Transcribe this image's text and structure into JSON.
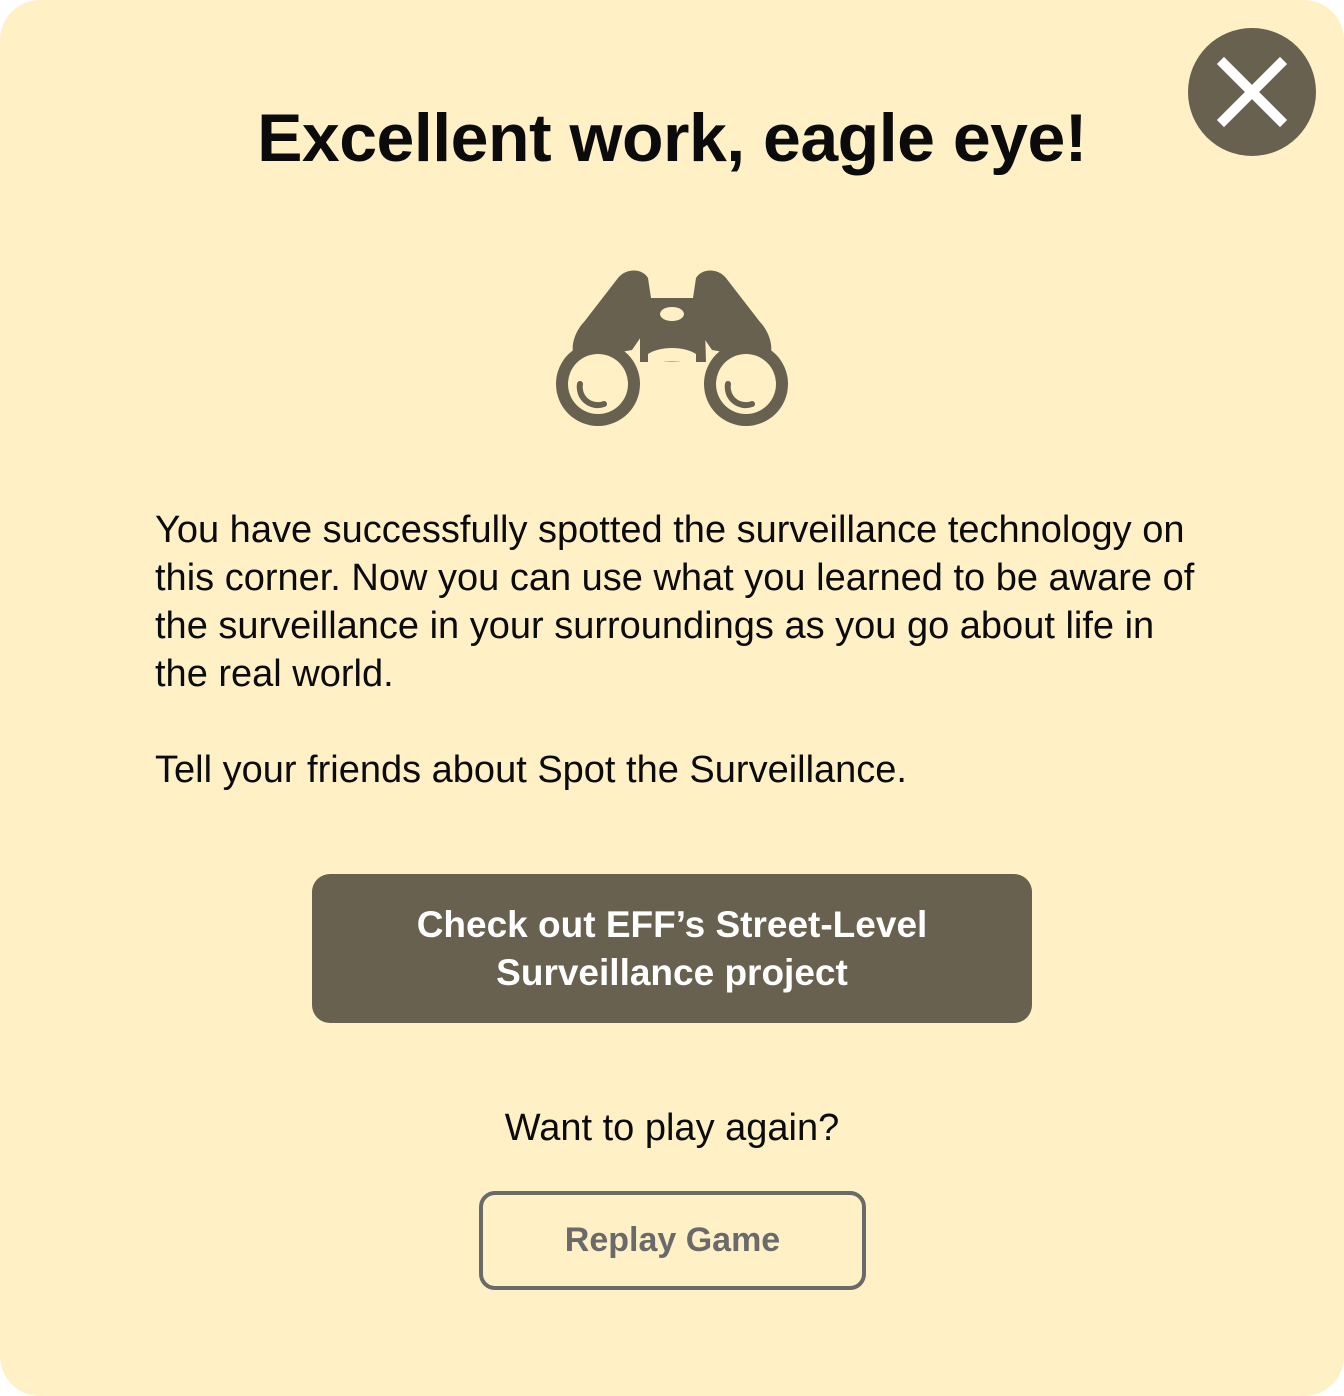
{
  "dialog": {
    "title": "Excellent work, eagle eye!",
    "icon": "binoculars-icon",
    "close_icon": "close-icon",
    "body": "You have successfully spotted the surveillance technology on this corner. Now you can use what you learned to be aware of the surveillance in your surroundings as you go about life in the real world.",
    "share": "Tell your friends about Spot the Surveillance.",
    "eff_button_label": "Check out EFF’s Street-Level Surveillance project",
    "replay_prompt": "Want to play again?",
    "replay_button_label": "Replay Game"
  },
  "colors": {
    "background": "#fff0c6",
    "accent": "#68614f",
    "outline_button": "#6a6a6a",
    "text": "#0b0b0b"
  }
}
